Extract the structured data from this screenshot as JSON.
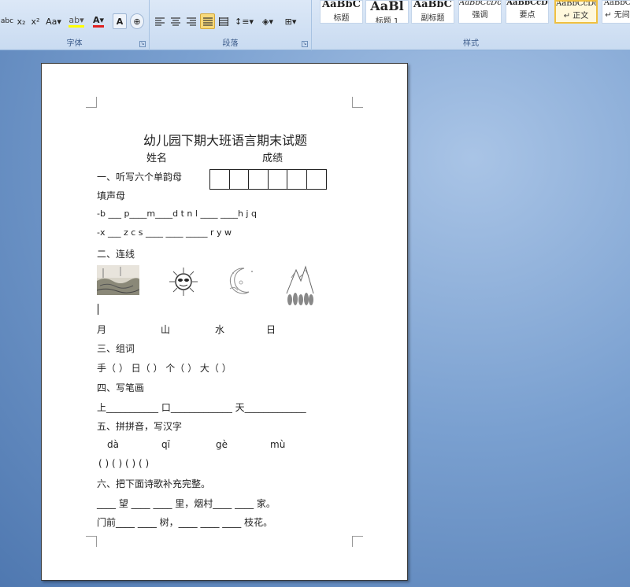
{
  "ribbon": {
    "font_group_label": "字体",
    "paragraph_group_label": "段落",
    "styles_group_label": "样式",
    "font_buttons": [
      "abc",
      "x₂",
      "x²",
      "Aa▾"
    ],
    "styles": [
      {
        "sample": "AaBbC",
        "name": "标题"
      },
      {
        "sample": "AaBl",
        "name": "标题 1"
      },
      {
        "sample": "AaBbC",
        "name": "副标题"
      },
      {
        "sample": "AaBbCcDc",
        "name": "强调"
      },
      {
        "sample": "AaBbCcD",
        "name": "要点"
      },
      {
        "sample": "AaBbCcDc",
        "name": "↵ 正文"
      },
      {
        "sample": "AaBbC",
        "name": "↵ 无间"
      }
    ]
  },
  "document": {
    "title": "幼儿园下期大班语言期末试题",
    "name_label": "姓名",
    "score_label": "成绩",
    "q1": "一、听写六个单韵母",
    "q1_sub": "填声母",
    "q1_line1": "-b ___ p____m____d   t   n   l    ____  ____h j   q",
    "q1_line2": "-x ___ z c s      ____  ____  _____  r   y   w",
    "q2": "二、连线",
    "q2_words": [
      "月",
      "山",
      "水",
      "日"
    ],
    "q3": "三、组词",
    "q3_line": "手（       ）   日（       ）  个（     ）      大（     ）",
    "q4": "四、写笔画",
    "q4_line": "上___________    口_____________    天_____________",
    "q5": "五、拼拼音，写汉字",
    "q5_pinyin": [
      "dà",
      "qī",
      "gè",
      "mù"
    ],
    "q5_brackets": "(       )       (       )       (       )       (       )",
    "q6": "六、把下面诗歌补充完整。",
    "q6_line1": "____ 望 ____ ____ 里，烟村____ ____ 家。",
    "q6_line2": "门前____ ____ 树，____ ____ ____ 枝花。"
  }
}
